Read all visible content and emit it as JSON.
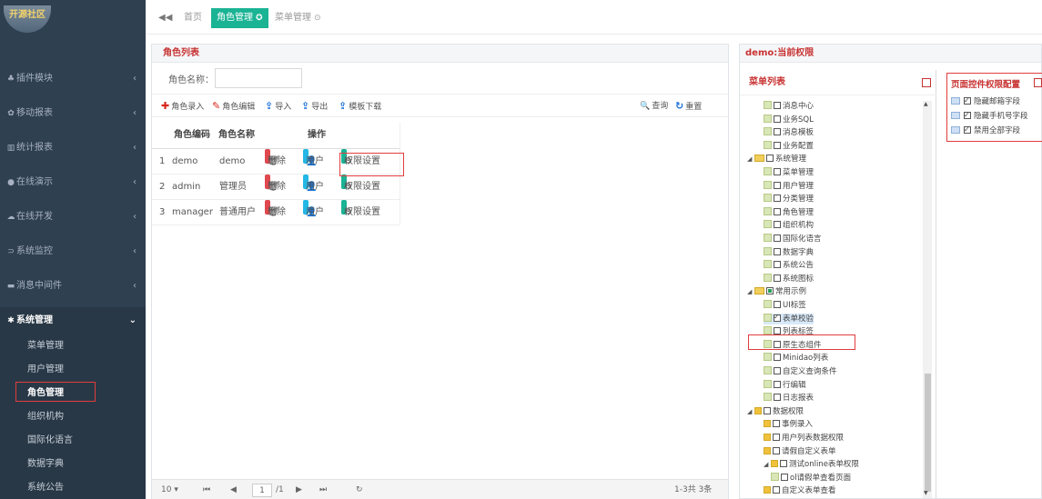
{
  "logo": {
    "text": "开源社区"
  },
  "sidebar": {
    "items": [
      {
        "icon": "puzzle-icon",
        "glyph": "♣",
        "label": "插件模块"
      },
      {
        "icon": "mobile-icon",
        "glyph": "✿",
        "label": "移动报表"
      },
      {
        "icon": "bar-chart-icon",
        "glyph": "▥",
        "label": "统计报表"
      },
      {
        "icon": "play-icon",
        "glyph": "●",
        "label": "在线演示"
      },
      {
        "icon": "cloud-icon",
        "glyph": "☁",
        "label": "在线开发"
      },
      {
        "icon": "monitor-icon",
        "glyph": "⊃",
        "label": "系统监控"
      },
      {
        "icon": "message-icon",
        "glyph": "▬",
        "label": "消息中间件"
      },
      {
        "icon": "settings-icon",
        "glyph": "✱",
        "label": "系统管理"
      }
    ],
    "chevron": "‹",
    "chevron_open": "⌄",
    "submenu": [
      "菜单管理",
      "用户管理",
      "角色管理",
      "组织机构",
      "国际化语言",
      "数据字典",
      "系统公告"
    ]
  },
  "tabs": {
    "back": "◀◀",
    "items": [
      {
        "label": "首页",
        "close": ""
      },
      {
        "label": "角色管理",
        "close": "✪"
      },
      {
        "label": "菜单管理",
        "close": "⊙"
      }
    ]
  },
  "role_panel": {
    "title": "角色列表",
    "search_label": "角色名称：",
    "search_value": "",
    "toolbar": {
      "add": "角色录入",
      "add_glyph": "✚",
      "edit": "角色编辑",
      "edit_glyph": "✎",
      "import": "导入",
      "import_glyph": "⇪",
      "export": "导出",
      "export_glyph": "⇪",
      "template": "模板下载",
      "template_glyph": "⇪",
      "query": "查询",
      "query_glyph": "🔍",
      "reset": "重置",
      "reset_glyph": "↻"
    },
    "columns": [
      "角色编码",
      "角色名称",
      "操作"
    ],
    "actions": {
      "delete": "删除",
      "delete_glyph": "🗑",
      "user": "用户",
      "user_glyph": "👤",
      "perm": "权限设置",
      "perm_glyph": "⚙"
    },
    "rows": [
      {
        "no": "1",
        "code": "demo",
        "name": "demo"
      },
      {
        "no": "2",
        "code": "admin",
        "name": "管理员"
      },
      {
        "no": "3",
        "code": "manager",
        "name": "普通用户"
      }
    ],
    "pager": {
      "page_size": "10 ▾",
      "first": "⏮",
      "prev": "◀",
      "page": "1",
      "total_pages": "/1",
      "next": "▶",
      "last": "⏭",
      "refresh": "↻",
      "summary": "1-3共 3条"
    }
  },
  "perm_panel": {
    "title": "demo:当前权限",
    "menu_title": "菜单列表",
    "ctrl_title": "页面控件权限配置",
    "tree": [
      {
        "label": "消息中心",
        "indent": 2,
        "kind": "file",
        "check": "off"
      },
      {
        "label": "业务SQL",
        "indent": 2,
        "kind": "file",
        "check": "off"
      },
      {
        "label": "消息模板",
        "indent": 2,
        "kind": "file",
        "check": "off"
      },
      {
        "label": "业务配置",
        "indent": 2,
        "kind": "file",
        "check": "off"
      },
      {
        "label": "系统管理",
        "indent": 1,
        "kind": "folder",
        "check": "off",
        "tri": "◢"
      },
      {
        "label": "菜单管理",
        "indent": 2,
        "kind": "file",
        "check": "off"
      },
      {
        "label": "用户管理",
        "indent": 2,
        "kind": "file",
        "check": "off"
      },
      {
        "label": "分类管理",
        "indent": 2,
        "kind": "file",
        "check": "off"
      },
      {
        "label": "角色管理",
        "indent": 2,
        "kind": "file",
        "check": "off"
      },
      {
        "label": "组织机构",
        "indent": 2,
        "kind": "file",
        "check": "off"
      },
      {
        "label": "国际化语言",
        "indent": 2,
        "kind": "file",
        "check": "off"
      },
      {
        "label": "数据字典",
        "indent": 2,
        "kind": "file",
        "check": "off"
      },
      {
        "label": "系统公告",
        "indent": 2,
        "kind": "file",
        "check": "off"
      },
      {
        "label": "系统图标",
        "indent": 2,
        "kind": "file",
        "check": "off"
      },
      {
        "label": "常用示例",
        "indent": 1,
        "kind": "folder",
        "check": "partial",
        "tri": "◢"
      },
      {
        "label": "UI标签",
        "indent": 2,
        "kind": "file",
        "check": "off"
      },
      {
        "label": "表单校验",
        "indent": 2,
        "kind": "file",
        "check": "on",
        "selected": true
      },
      {
        "label": "列表标签",
        "indent": 2,
        "kind": "file",
        "check": "off"
      },
      {
        "label": "原生态组件",
        "indent": 2,
        "kind": "file",
        "check": "off"
      },
      {
        "label": "Minidao列表",
        "indent": 2,
        "kind": "file",
        "check": "off"
      },
      {
        "label": "自定义查询条件",
        "indent": 2,
        "kind": "file",
        "check": "off"
      },
      {
        "label": "行编辑",
        "indent": 2,
        "kind": "file",
        "check": "off"
      },
      {
        "label": "日志报表",
        "indent": 2,
        "kind": "file",
        "check": "off"
      },
      {
        "label": "数据权限",
        "indent": 1,
        "kind": "key",
        "check": "off",
        "tri": "◢"
      },
      {
        "label": "事例录入",
        "indent": 2,
        "kind": "key",
        "check": "off"
      },
      {
        "label": "用户列表数据权限",
        "indent": 2,
        "kind": "key",
        "check": "off"
      },
      {
        "label": "请假自定义表单",
        "indent": 2,
        "kind": "key",
        "check": "off"
      },
      {
        "label": "测试online表单权限",
        "indent": 2,
        "kind": "key",
        "check": "off",
        "tri": "◢"
      },
      {
        "label": "ol请假单查看页面",
        "indent": 3,
        "kind": "file",
        "check": "off"
      },
      {
        "label": "自定义表单查看",
        "indent": 2,
        "kind": "key",
        "check": "off"
      }
    ],
    "controls": [
      "隐藏邮箱字段",
      "隐藏手机号字段",
      "禁用全部字段"
    ],
    "scroll_up": "▲",
    "scroll_down": "▼"
  }
}
